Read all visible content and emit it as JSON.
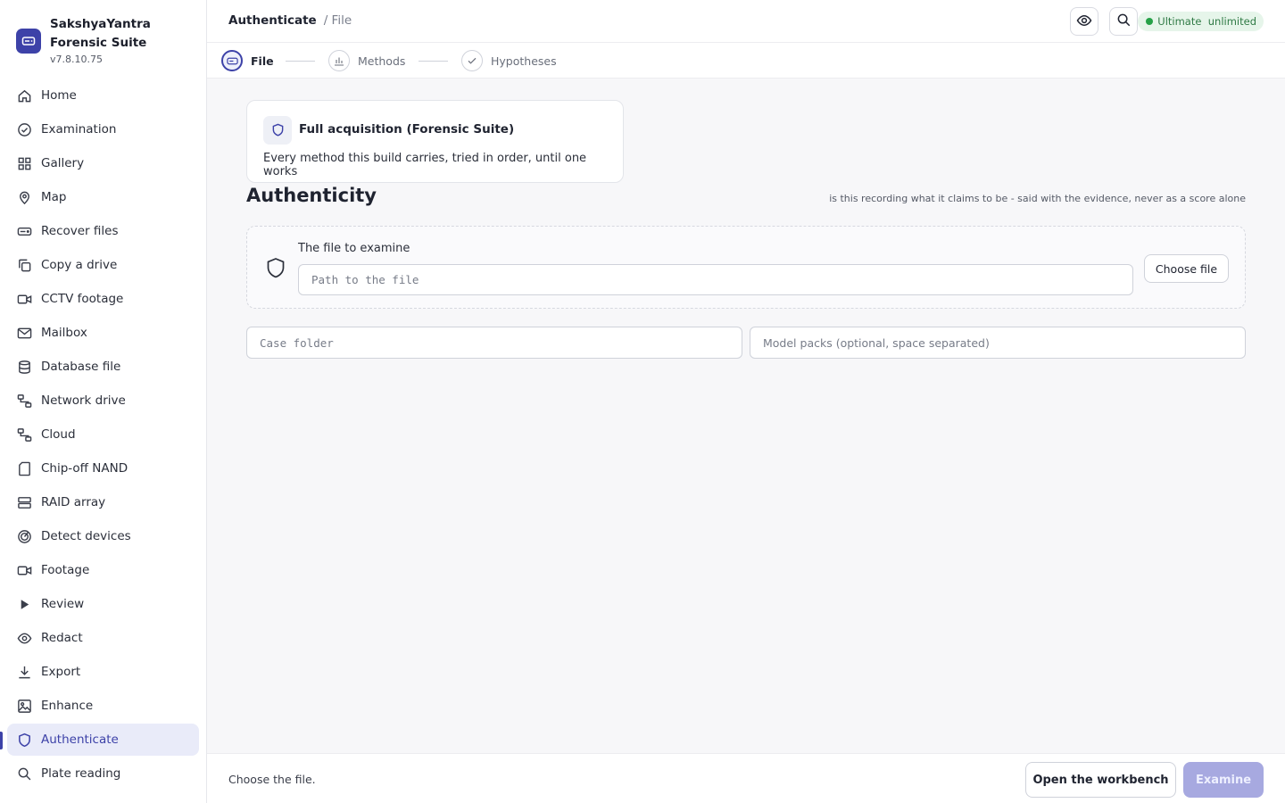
{
  "app": {
    "name": "SakshyaYantra Forensic Suite",
    "version": "v7.8.10.75"
  },
  "sidebar": {
    "items": [
      {
        "label": "Home",
        "icon": "home-icon"
      },
      {
        "label": "Examination",
        "icon": "check-circle-icon"
      },
      {
        "label": "Gallery",
        "icon": "grid-icon"
      },
      {
        "label": "Map",
        "icon": "map-pin-icon"
      },
      {
        "label": "Recover files",
        "icon": "hard-drive-icon"
      },
      {
        "label": "Copy a drive",
        "icon": "copy-icon"
      },
      {
        "label": "CCTV footage",
        "icon": "video-icon"
      },
      {
        "label": "Mailbox",
        "icon": "mail-icon"
      },
      {
        "label": "Database file",
        "icon": "database-icon"
      },
      {
        "label": "Network drive",
        "icon": "network-icon"
      },
      {
        "label": "Cloud",
        "icon": "network-icon"
      },
      {
        "label": "Chip-off NAND",
        "icon": "sd-card-icon"
      },
      {
        "label": "RAID array",
        "icon": "server-icon"
      },
      {
        "label": "Detect devices",
        "icon": "radar-icon"
      },
      {
        "label": "Footage",
        "icon": "video-icon"
      },
      {
        "label": "Review",
        "icon": "play-icon"
      },
      {
        "label": "Redact",
        "icon": "eye-icon"
      },
      {
        "label": "Export",
        "icon": "download-icon"
      },
      {
        "label": "Enhance",
        "icon": "image-icon"
      },
      {
        "label": "Authenticate",
        "icon": "shield-icon"
      },
      {
        "label": "Plate reading",
        "icon": "search-icon"
      }
    ],
    "active": "Authenticate"
  },
  "header": {
    "breadcrumb_main": "Authenticate",
    "breadcrumb_sub": "/ File",
    "license_badge": "Ultimate  unlimited",
    "badge_color": "#26a148"
  },
  "stepper": {
    "steps": [
      {
        "label": "File",
        "state": "current"
      },
      {
        "label": "Methods",
        "state": "pending"
      },
      {
        "label": "Hypotheses",
        "state": "pending"
      }
    ]
  },
  "card": {
    "title": "Full acquisition (Forensic Suite)",
    "description": "Every method this build carries, tried in order, until one works"
  },
  "main": {
    "title": "Authenticity",
    "subtitle": "is this recording what it claims to be - said with the evidence, never as a score alone",
    "file_label": "The file to examine",
    "path_placeholder": "Path to the file",
    "choose_file_label": "Choose file",
    "case_placeholder": "Case folder",
    "models_placeholder": "Model packs (optional, space separated)"
  },
  "footer": {
    "status": "Choose the file.",
    "workbench_label": "Open the workbench",
    "examine_label": "Examine"
  },
  "colors": {
    "accent": "#3d42a8",
    "examine_disabled": "#a7a9e0"
  }
}
